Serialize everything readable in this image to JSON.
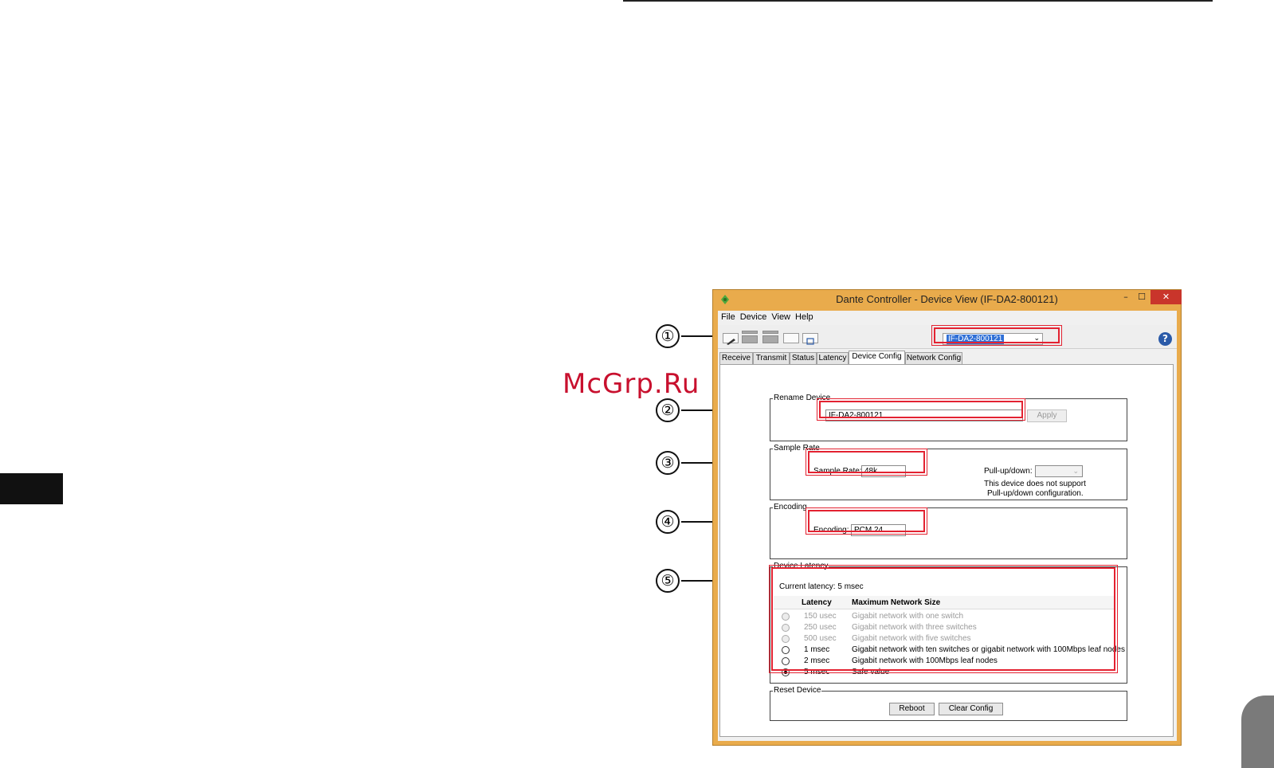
{
  "watermark": "McGrp.Ru",
  "window": {
    "title": "Dante Controller - Device View (IF-DA2-800121)",
    "minimize": "–",
    "maximize": "☐",
    "close": "✕"
  },
  "menu": [
    "File",
    "Device",
    "View",
    "Help"
  ],
  "toolbar": {
    "device_selected": "IF-DA2-800121",
    "help": "?"
  },
  "tabs": [
    "Receive",
    "Transmit",
    "Status",
    "Latency",
    "Device Config",
    "Network Config"
  ],
  "active_tab": "Device Config",
  "rename": {
    "title": "Rename Device",
    "value": "IF-DA2-800121",
    "apply": "Apply"
  },
  "sample_rate": {
    "title": "Sample Rate",
    "label": "Sample Rate:",
    "value": "48k",
    "pullup_label": "Pull-up/down:",
    "pullup_value": "",
    "note_line1": "This device does not support",
    "note_line2": "Pull-up/down configuration."
  },
  "encoding": {
    "title": "Encoding",
    "label": "Encoding:",
    "value": "PCM 24"
  },
  "latency": {
    "title": "Device Latency",
    "current": "Current latency: 5 msec",
    "col_latency": "Latency",
    "col_size": "Maximum Network Size",
    "rows": [
      {
        "value": "150 usec",
        "desc": "Gigabit network with one switch",
        "enabled": false,
        "checked": false
      },
      {
        "value": "250 usec",
        "desc": "Gigabit network with three switches",
        "enabled": false,
        "checked": false
      },
      {
        "value": "500 usec",
        "desc": "Gigabit network with five switches",
        "enabled": false,
        "checked": false
      },
      {
        "value": "1 msec",
        "desc": "Gigabit network with ten switches or gigabit network with 100Mbps leaf nodes",
        "enabled": true,
        "checked": false
      },
      {
        "value": "2 msec",
        "desc": "Gigabit network with 100Mbps leaf nodes",
        "enabled": true,
        "checked": false
      },
      {
        "value": "5 msec",
        "desc": "Safe value",
        "enabled": true,
        "checked": true
      }
    ]
  },
  "reset": {
    "title": "Reset Device",
    "reboot": "Reboot",
    "clear": "Clear Config"
  },
  "callouts": [
    "①",
    "②",
    "③",
    "④",
    "⑤"
  ],
  "colors": {
    "window_frame": "#e9ab4c",
    "highlight": "#e32231",
    "close_button": "#c9352b",
    "selection": "#2f6fd6"
  }
}
